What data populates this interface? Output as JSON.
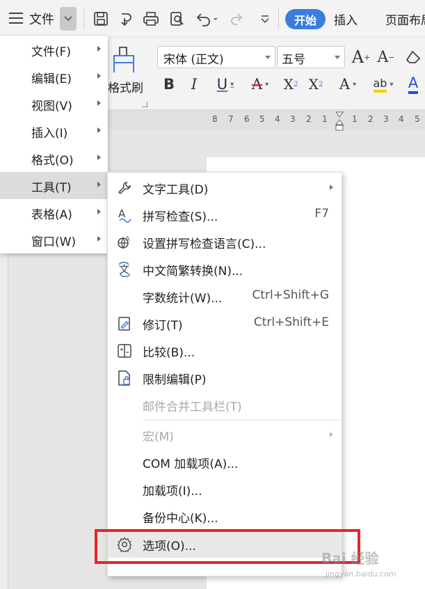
{
  "toolbar": {
    "file_label": "文件",
    "tabs": {
      "home": "开始",
      "insert": "插入",
      "layout": "页面布局"
    }
  },
  "ribbon": {
    "format_painter": "格式刷",
    "font_name": "宋体 (正文)",
    "font_size": "五号"
  },
  "ruler": {
    "numbers": [
      "8",
      "7",
      "6",
      "5",
      "4",
      "3",
      "2",
      "1",
      "1",
      "2",
      "3",
      "4",
      "5"
    ]
  },
  "main_menu": {
    "items": [
      {
        "label": "文件(F)"
      },
      {
        "label": "编辑(E)"
      },
      {
        "label": "视图(V)"
      },
      {
        "label": "插入(I)"
      },
      {
        "label": "格式(O)"
      },
      {
        "label": "工具(T)"
      },
      {
        "label": "表格(A)"
      },
      {
        "label": "窗口(W)"
      }
    ],
    "active": "工具(T)"
  },
  "tools_menu": {
    "items": [
      {
        "label": "文字工具(D)",
        "icon": "wrench-icon",
        "submenu": true
      },
      {
        "label": "拼写检查(S)...",
        "icon": "spell-check-icon",
        "shortcut": "F7"
      },
      {
        "label": "设置拼写检查语言(C)...",
        "icon": "globe-language-icon"
      },
      {
        "label": "中文简繁转换(N)...",
        "icon": "chinese-convert-icon"
      },
      {
        "label": "字数统计(W)...",
        "shortcut": "Ctrl+Shift+G"
      },
      {
        "label": "修订(T)",
        "icon": "track-changes-icon",
        "shortcut": "Ctrl+Shift+E"
      },
      {
        "label": "比较(B)...",
        "icon": "compare-icon"
      },
      {
        "label": "限制编辑(P)",
        "icon": "restrict-edit-icon"
      },
      {
        "label": "邮件合并工具栏(T)",
        "disabled": true
      },
      {
        "label": "宏(M)",
        "disabled": true,
        "submenu": true
      },
      {
        "label": "COM 加载项(A)..."
      },
      {
        "label": "加载项(I)..."
      },
      {
        "label": "备份中心(K)..."
      },
      {
        "label": "选项(O)...",
        "icon": "gear-icon",
        "highlighted": true
      }
    ]
  },
  "watermark": {
    "text": "Bai 经验",
    "sub": "jingyan.baidu.com"
  },
  "colors": {
    "accent": "#3b7ddd",
    "highlight_box": "#e3262a"
  }
}
